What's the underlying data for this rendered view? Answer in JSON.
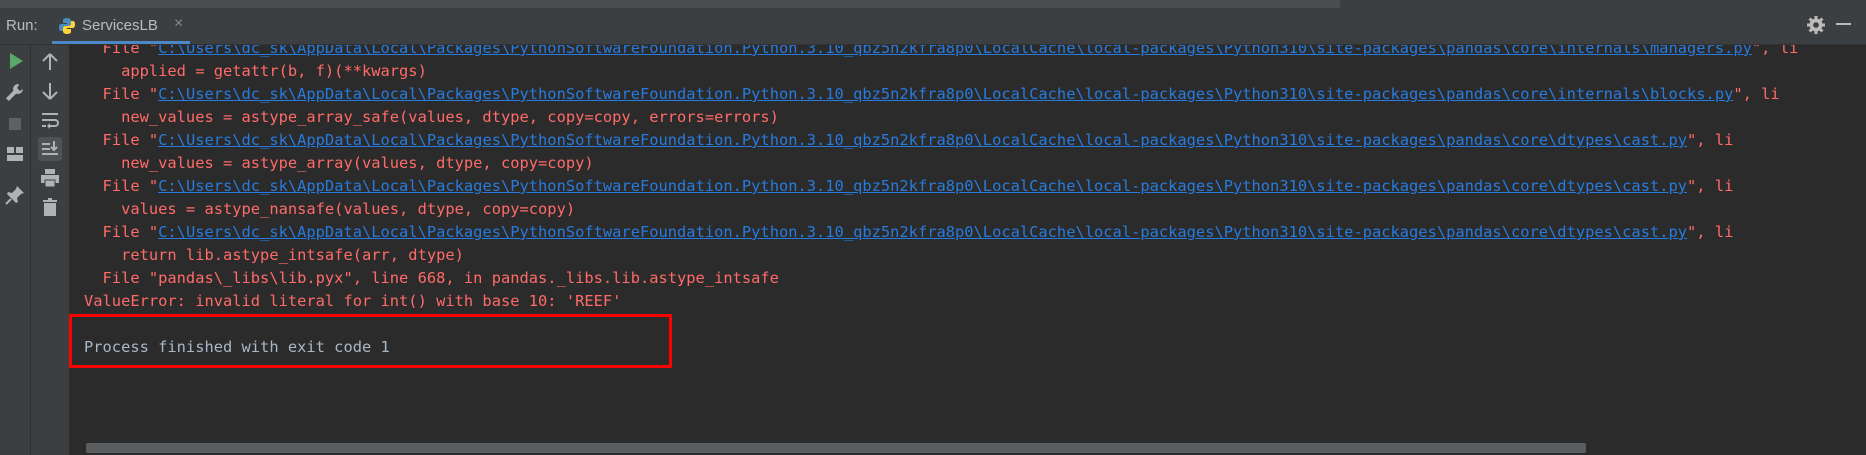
{
  "toolbar": {
    "run_label": "Run:",
    "tab_label": "ServicesLB",
    "close_glyph": "×"
  },
  "colors": {
    "background": "#2b2b2b",
    "panel": "#3c3f41",
    "error_text": "#ff6b68",
    "link": "#287bde",
    "plain_text": "#a9b7c6",
    "highlight_box": "#ff0000",
    "run_green": "#59a869"
  },
  "icons": {
    "left_strip": [
      "run-icon",
      "wrench-icon",
      "stop-icon",
      "layout-icon",
      "pin-icon"
    ],
    "second_strip": [
      "arrow-up-icon",
      "arrow-down-icon",
      "soft-wrap-icon",
      "scroll-to-end-icon",
      "print-icon",
      "trash-icon"
    ],
    "header": [
      "python-file-icon",
      "gear-icon",
      "minimize-icon"
    ]
  },
  "console": {
    "line0": {
      "prefix": "  File \"",
      "path": "C:\\Users\\dc_sk\\AppData\\Local\\Packages\\PythonSoftwareFoundation.Python.3.10_qbz5n2kfra8p0\\LocalCache\\local-packages\\Python310\\site-packages\\pandas\\core\\internals\\managers.py",
      "suffix": "\", li"
    },
    "line1": "    applied = getattr(b, f)(**kwargs)",
    "line2": {
      "prefix": "  File \"",
      "path": "C:\\Users\\dc_sk\\AppData\\Local\\Packages\\PythonSoftwareFoundation.Python.3.10_qbz5n2kfra8p0\\LocalCache\\local-packages\\Python310\\site-packages\\pandas\\core\\internals\\blocks.py",
      "suffix": "\", li"
    },
    "line3": "    new_values = astype_array_safe(values, dtype, copy=copy, errors=errors)",
    "line4": {
      "prefix": "  File \"",
      "path": "C:\\Users\\dc_sk\\AppData\\Local\\Packages\\PythonSoftwareFoundation.Python.3.10_qbz5n2kfra8p0\\LocalCache\\local-packages\\Python310\\site-packages\\pandas\\core\\dtypes\\cast.py",
      "suffix": "\", li"
    },
    "line5": "    new_values = astype_array(values, dtype, copy=copy)",
    "line6": {
      "prefix": "  File \"",
      "path": "C:\\Users\\dc_sk\\AppData\\Local\\Packages\\PythonSoftwareFoundation.Python.3.10_qbz5n2kfra8p0\\LocalCache\\local-packages\\Python310\\site-packages\\pandas\\core\\dtypes\\cast.py",
      "suffix": "\", li"
    },
    "line7": "    values = astype_nansafe(values, dtype, copy=copy)",
    "line8": {
      "prefix": "  File \"",
      "path": "C:\\Users\\dc_sk\\AppData\\Local\\Packages\\PythonSoftwareFoundation.Python.3.10_qbz5n2kfra8p0\\LocalCache\\local-packages\\Python310\\site-packages\\pandas\\core\\dtypes\\cast.py",
      "suffix": "\", li"
    },
    "line9": "    return lib.astype_intsafe(arr, dtype)",
    "line10": "  File \"pandas\\_libs\\lib.pyx\", line 668, in pandas._libs.lib.astype_intsafe",
    "line11": "ValueError: invalid literal for int() with base 10: 'REEF'",
    "line12": "Process finished with exit code 1"
  }
}
